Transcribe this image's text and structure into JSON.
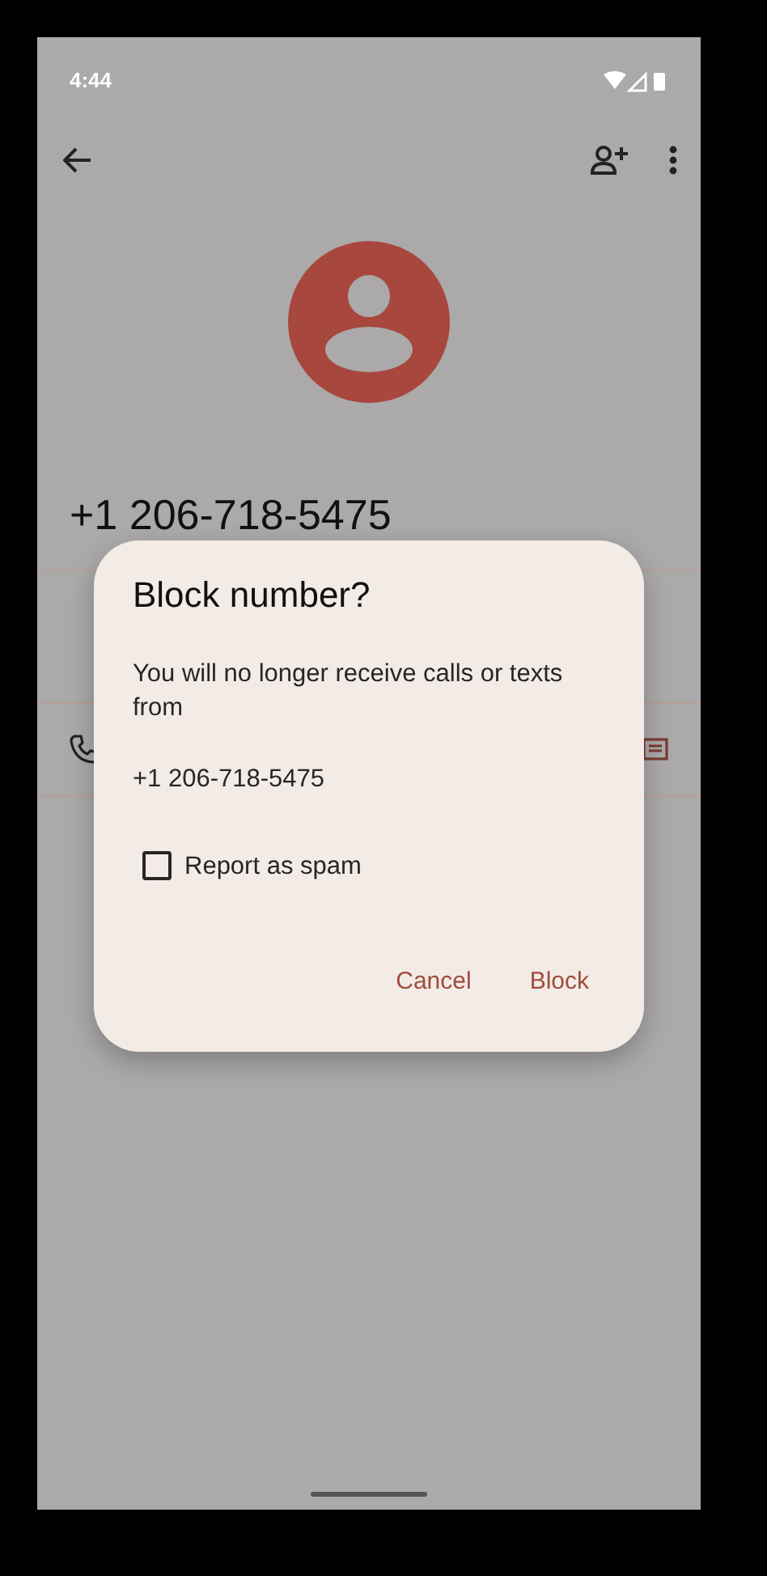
{
  "status_bar": {
    "time": "4:44"
  },
  "contact": {
    "number": "+1 206-718-5475"
  },
  "dialog": {
    "title": "Block number?",
    "message": "You will no longer receive calls or texts from",
    "number": "+1 206-718-5475",
    "checkbox": {
      "label": "Report as spam",
      "checked": false
    },
    "buttons": [
      {
        "label": "Cancel"
      },
      {
        "label": "Block"
      }
    ]
  }
}
